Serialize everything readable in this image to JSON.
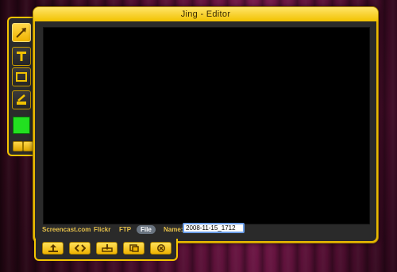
{
  "window": {
    "title": "Jing - Editor"
  },
  "tools": [
    {
      "name": "arrow",
      "icon": "arrow-icon",
      "selected": true
    },
    {
      "name": "text",
      "icon": "text-icon",
      "selected": false
    },
    {
      "name": "frame",
      "icon": "rectangle-icon",
      "selected": false
    },
    {
      "name": "highlight",
      "icon": "highlighter-icon",
      "selected": false
    }
  ],
  "color_swatch": "#22e020",
  "share": {
    "links": [
      "Screencast.com",
      "Flickr",
      "FTP",
      "File"
    ],
    "active": "File",
    "name_label": "Name:",
    "name_value": "2008-11-15_1712"
  },
  "actions": [
    {
      "icon": "share-icon"
    },
    {
      "icon": "embed-code-icon"
    },
    {
      "icon": "save-icon"
    },
    {
      "icon": "copy-icon"
    },
    {
      "icon": "cancel-icon"
    }
  ]
}
